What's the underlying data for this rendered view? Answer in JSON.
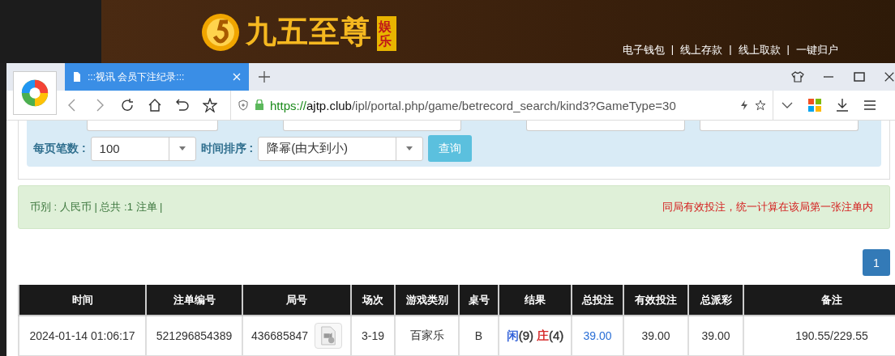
{
  "site": {
    "logo_text": "九五至尊",
    "badge": "娱乐",
    "links": [
      "电子钱包",
      "线上存款",
      "线上取款",
      "一键归户"
    ],
    "separator": "|"
  },
  "browser": {
    "tab": {
      "title": ":::视讯 会员下注纪录:::",
      "selected": true
    },
    "url": {
      "scheme": "https://",
      "domain": "ajtp.club",
      "path": "/ipl/portal.php/game/betrecord_search/kind3?GameType=30"
    }
  },
  "filters": {
    "per_page": {
      "label": "每页笔数 :",
      "value": "100"
    },
    "sort": {
      "label": "时间排序 :",
      "value": "降幂(由大到小)"
    },
    "query_button": "查询"
  },
  "summary": {
    "left": "币别 : 人民币 | 总共 :1 注单 |",
    "right": "同局有效投注，统一计算在该局第一张注单内"
  },
  "pagination": [
    {
      "label": "1",
      "selected": true
    }
  ],
  "table": {
    "columns": [
      "时间",
      "注单编号",
      "局号",
      "场次",
      "游戏类别",
      "桌号",
      "结果",
      "总投注",
      "有效投注",
      "总派彩",
      "备注"
    ],
    "rows": [
      {
        "cells": [
          {
            "kind": "text",
            "text": "2024-01-14 01:06:17"
          },
          {
            "kind": "text",
            "text": "521296854389"
          },
          {
            "kind": "round",
            "text": "436685847"
          },
          {
            "kind": "text",
            "text": "3-19"
          },
          {
            "kind": "text",
            "text": "百家乐"
          },
          {
            "kind": "text",
            "text": "B"
          },
          {
            "kind": "result",
            "parts": [
              {
                "text": "闲",
                "color": "#2a5bd7"
              },
              {
                "text": "(9)",
                "color": "#333333"
              },
              {
                "text": "庄",
                "color": "#d42020"
              },
              {
                "text": "(4)",
                "color": "#333333"
              }
            ]
          },
          {
            "kind": "link",
            "text": "39.00"
          },
          {
            "kind": "text",
            "text": "39.00"
          },
          {
            "kind": "text",
            "text": "39.00"
          },
          {
            "kind": "text",
            "text": "190.55/229.55"
          }
        ]
      }
    ]
  }
}
